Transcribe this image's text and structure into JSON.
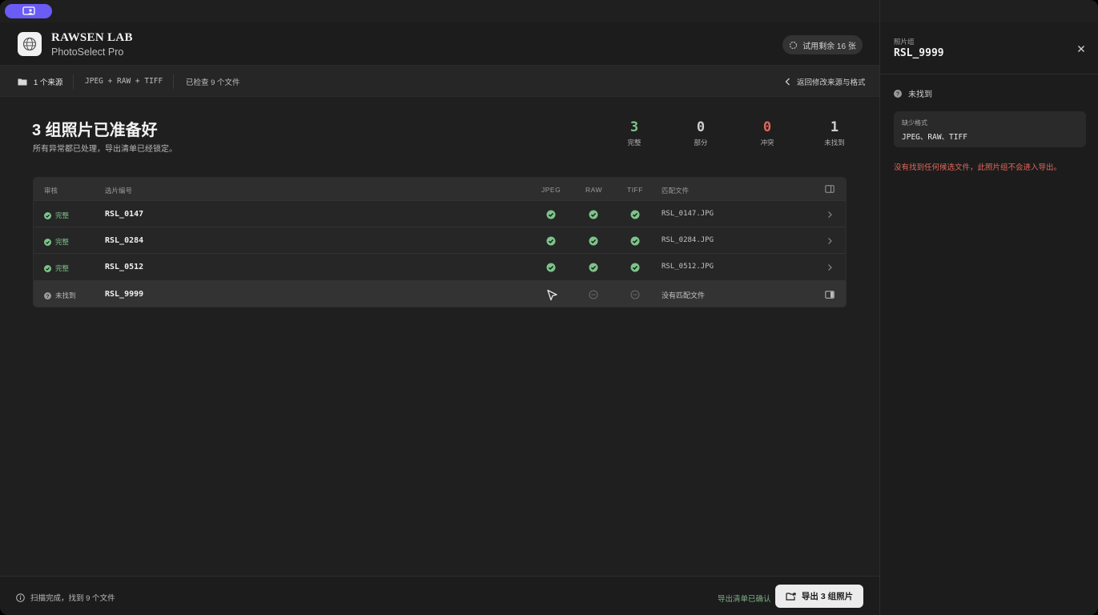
{
  "header": {
    "brand": "RAWSEN LAB",
    "product": "PhotoSelect Pro",
    "trial": "试用剩余 16 张"
  },
  "subbar": {
    "sources": "1 个来源",
    "formats": "JPEG + RAW + TIFF",
    "checked": "已检查 9 个文件",
    "back": "返回修改来源与格式"
  },
  "summary": {
    "title": "3 组照片已准备好",
    "subtitle": "所有异常都已处理，导出清单已经锁定。",
    "stats": [
      {
        "value": "3",
        "label": "完整",
        "color": "#7dc48a"
      },
      {
        "value": "0",
        "label": "部分",
        "color": "#cfcfcf"
      },
      {
        "value": "0",
        "label": "冲突",
        "color": "#e0675a"
      },
      {
        "value": "1",
        "label": "未找到",
        "color": "#cfcfcf"
      }
    ]
  },
  "table": {
    "headers": {
      "review": "审核",
      "id": "选片编号",
      "jpeg": "JPEG",
      "raw": "RAW",
      "tiff": "TIFF",
      "file": "匹配文件"
    },
    "rows": [
      {
        "status": "完整",
        "id": "RSL_0147",
        "jpeg": "ok",
        "raw": "ok",
        "tiff": "ok",
        "file": "RSL_0147.JPG"
      },
      {
        "status": "完整",
        "id": "RSL_0284",
        "jpeg": "ok",
        "raw": "ok",
        "tiff": "ok",
        "file": "RSL_0284.JPG"
      },
      {
        "status": "完整",
        "id": "RSL_0512",
        "jpeg": "ok",
        "raw": "ok",
        "tiff": "ok",
        "file": "RSL_0512.JPG"
      },
      {
        "status": "未找到",
        "id": "RSL_9999",
        "jpeg": "cursor",
        "raw": "none",
        "tiff": "none",
        "file": "没有匹配文件"
      }
    ]
  },
  "footer": {
    "info": "扫描完成，找到 9 个文件",
    "confirm": "导出清单已确认",
    "export": "导出 3 组照片"
  },
  "panel": {
    "label": "照片组",
    "title": "RSL_9999",
    "status": "未找到",
    "missing_label": "缺少格式",
    "missing_value": "JPEG、RAW、TIFF",
    "warning": "没有找到任何候选文件，此照片组不会进入导出。"
  },
  "colors": {
    "ok": "#7dc48a",
    "danger": "#e0675a",
    "accent": "#6a5cf5"
  }
}
